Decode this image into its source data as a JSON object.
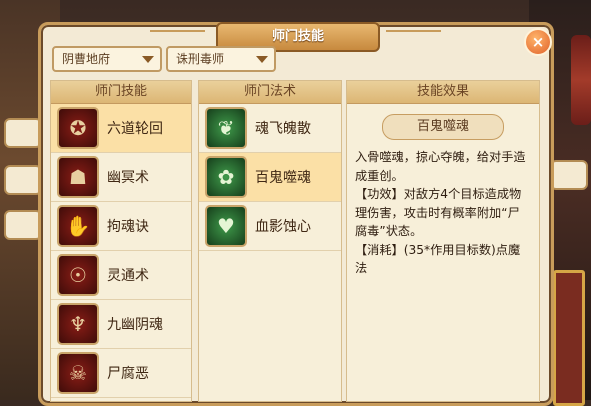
{
  "window": {
    "title": "师门技能",
    "close_symbol": "×"
  },
  "filters": {
    "region": "阴曹地府",
    "role": "诛刑毒师"
  },
  "columns": {
    "skills_header": "师门技能",
    "spells_header": "师门法术",
    "effect_header": "技能效果"
  },
  "skills": [
    {
      "label": "六道轮回",
      "icon": "wheel-icon",
      "selected": true
    },
    {
      "label": "幽冥术",
      "icon": "ghost-icon",
      "selected": false
    },
    {
      "label": "拘魂诀",
      "icon": "grasp-icon",
      "selected": false
    },
    {
      "label": "灵通术",
      "icon": "spirit-icon",
      "selected": false
    },
    {
      "label": "九幽阴魂",
      "icon": "souls-icon",
      "selected": false
    },
    {
      "label": "尸腐恶",
      "icon": "skull-icon",
      "selected": false
    }
  ],
  "spells": [
    {
      "label": "魂飞魄散",
      "icon": "soul-scatter-icon",
      "selected": false
    },
    {
      "label": "百鬼噬魂",
      "icon": "ghost-devour-icon",
      "selected": true
    },
    {
      "label": "血影蚀心",
      "icon": "blood-heart-icon",
      "selected": false
    }
  ],
  "effect": {
    "name": "百鬼噬魂",
    "lines": [
      "入骨噬魂，掠心夺魄，给对手造成重创。",
      "【功效】对敌方4个目标造成物理伤害，攻击时有概率附加“尸腐毒”状态。",
      "【消耗】(35*作用目标数)点魔法"
    ]
  },
  "colors": {
    "accent": "#c89c5b",
    "selected_row": "#fbe0a6",
    "panel": "#f3ead5"
  }
}
